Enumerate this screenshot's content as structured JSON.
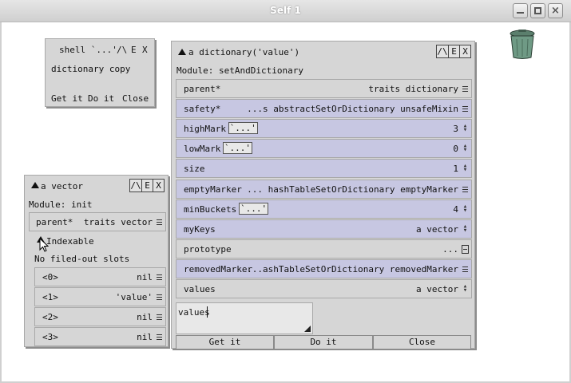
{
  "window": {
    "title": "Self 1",
    "minimize": "_",
    "maximize": "□",
    "close": "×"
  },
  "shell": {
    "title": "shell `...'",
    "caret": "/\\",
    "e": "E",
    "x": "X",
    "text": "dictionary copy",
    "buttons": [
      "Get it",
      "Do it",
      "Close"
    ]
  },
  "dictionary": {
    "title": "a dictionary('value')",
    "caret": "/\\",
    "e": "E",
    "x": "X",
    "module": "Module: setAndDictionary",
    "slots": [
      {
        "name": "parent*",
        "value": "traits dictionary",
        "control": "eq",
        "highlight": false,
        "dots": ""
      },
      {
        "name": "safety*",
        "value": "...s abstractSetOrDictionary unsafeMixin",
        "control": "eq",
        "highlight": true,
        "dots": ""
      },
      {
        "name": "highMark",
        "value": "3",
        "control": "ud",
        "highlight": true,
        "dots": "`...'"
      },
      {
        "name": "lowMark",
        "value": "0",
        "control": "ud",
        "highlight": true,
        "dots": "`...'"
      },
      {
        "name": "size",
        "value": "1",
        "control": "ud",
        "highlight": true,
        "dots": ""
      },
      {
        "name": "emptyMarker",
        "value": "... hashTableSetOrDictionary emptyMarker",
        "control": "eq",
        "highlight": true,
        "dots": ""
      },
      {
        "name": "minBuckets",
        "value": "4",
        "control": "ud",
        "highlight": true,
        "dots": "`...'"
      },
      {
        "name": "myKeys",
        "value": "a vector",
        "control": "ud",
        "highlight": true,
        "dots": ""
      },
      {
        "name": "prototype",
        "value": "...",
        "control": "box",
        "highlight": false,
        "dots": ""
      },
      {
        "name": "removedMarker",
        "value": "...ashTableSetOrDictionary removedMarker",
        "control": "eq",
        "highlight": true,
        "dots": ""
      },
      {
        "name": "values",
        "value": "a vector",
        "control": "ud",
        "highlight": false,
        "dots": ""
      }
    ],
    "editor_text": "values",
    "buttons": [
      "Get it",
      "Do it",
      "Close"
    ]
  },
  "vector": {
    "title": "a vector",
    "caret": "/\\",
    "e": "E",
    "x": "X",
    "module": "Module: init",
    "parent_name": "parent*",
    "parent_value": "traits vector",
    "indexable": "Indexable",
    "no_slots": "No filed-out slots",
    "items": [
      {
        "name": "<0>",
        "value": "nil"
      },
      {
        "name": "<1>",
        "value": "'value'"
      },
      {
        "name": "<2>",
        "value": "nil"
      },
      {
        "name": "<3>",
        "value": "nil"
      }
    ]
  },
  "trash": {
    "icon": "trash-can-icon"
  },
  "colors": {
    "slot_highlight": "#c7c7e2",
    "panel": "#d6d6d6",
    "trash": "#6f9a85"
  }
}
